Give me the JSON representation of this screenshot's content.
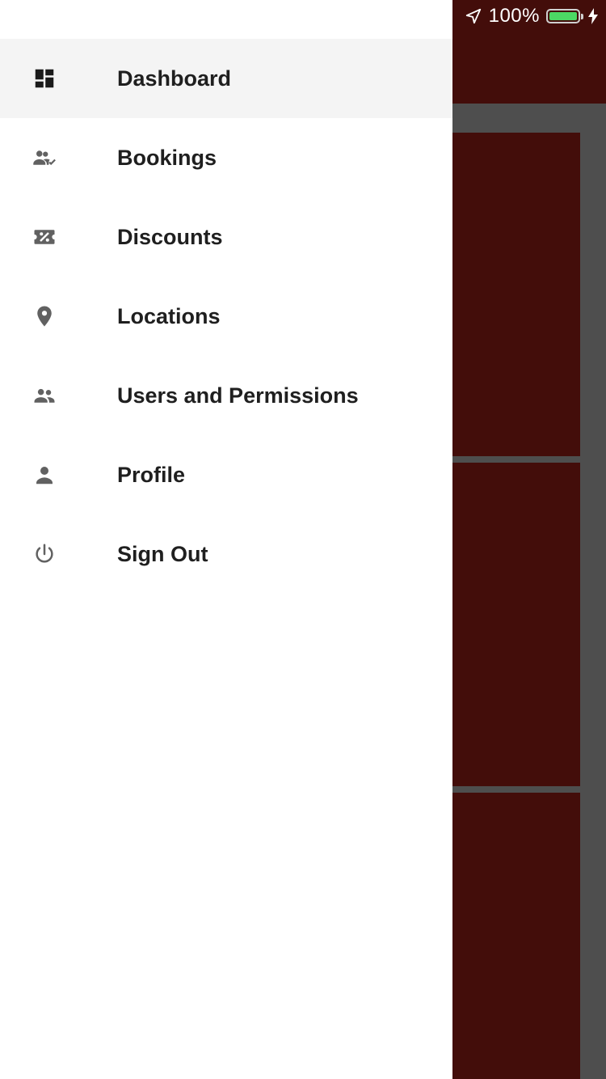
{
  "status_bar": {
    "battery_percent": "100%",
    "battery_color": "#4cd964",
    "location_icon": "location-arrow-icon",
    "charging_icon": "bolt-icon"
  },
  "drawer": {
    "items": [
      {
        "label": "Dashboard",
        "icon": "dashboard-icon",
        "active": true
      },
      {
        "label": "Bookings",
        "icon": "people-check-icon",
        "active": false
      },
      {
        "label": "Discounts",
        "icon": "discount-ticket-icon",
        "active": false
      },
      {
        "label": "Locations",
        "icon": "location-pin-icon",
        "active": false
      },
      {
        "label": "Users and Permissions",
        "icon": "people-icon",
        "active": false
      },
      {
        "label": "Profile",
        "icon": "person-icon",
        "active": false
      },
      {
        "label": "Sign Out",
        "icon": "power-icon",
        "active": false
      }
    ]
  },
  "colors": {
    "brand_dark_red": "#430d0a",
    "scrim_gray": "#4e4e4e",
    "active_item_bg": "#f4f4f4"
  }
}
